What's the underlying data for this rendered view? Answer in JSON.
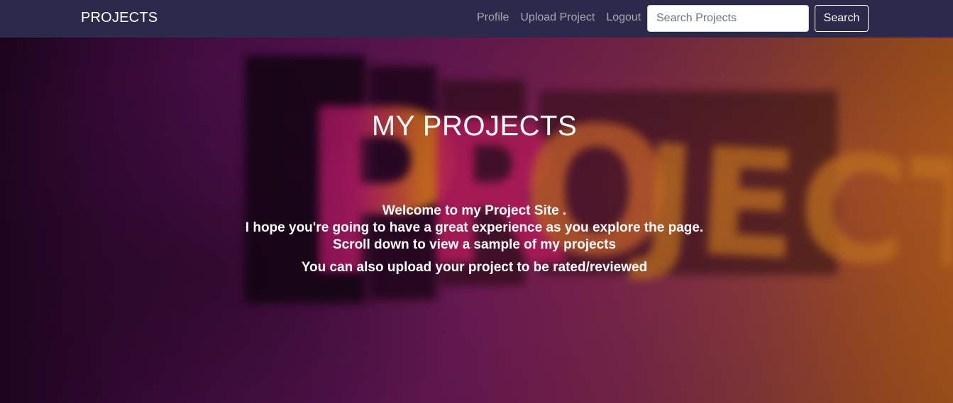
{
  "navbar": {
    "brand": "PROJECTS",
    "links": [
      "Profile",
      "Upload Project",
      "Logout"
    ],
    "search": {
      "placeholder": "Search Projects",
      "value": "",
      "button_label": "Search"
    },
    "background_color": "#2b2a4a"
  },
  "hero": {
    "title": "MY PROJECTS",
    "lines": [
      "Welcome to my Project Site .",
      "I hope you're going to have a great experience as you explore the page.",
      "Scroll down to view a sample of my projects",
      "You can also upload your project to be rated/reviewed"
    ]
  }
}
